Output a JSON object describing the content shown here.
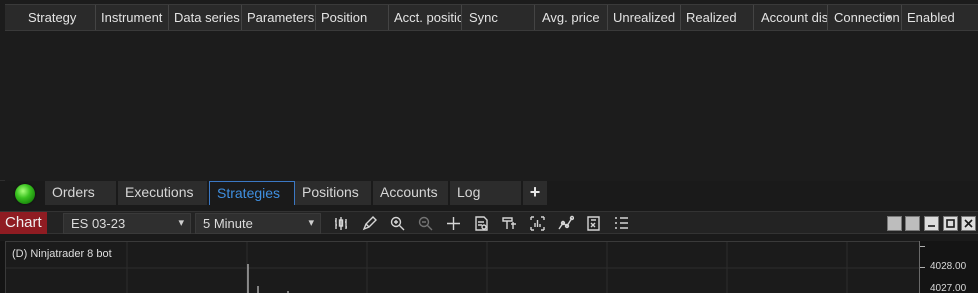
{
  "grid": {
    "columns": [
      "Strategy",
      "Instrument",
      "Data series",
      "Parameters",
      "Position",
      "Acct. position",
      "Sync",
      "Avg. price",
      "Unrealized",
      "Realized",
      "Account display name",
      "Connection",
      "Enabled"
    ]
  },
  "tabs": {
    "items": [
      "Orders",
      "Executions",
      "Strategies",
      "Positions",
      "Accounts",
      "Log"
    ],
    "active": "Strategies",
    "add_label": "+"
  },
  "toolbar": {
    "chart_label": "Chart",
    "instrument": "ES 03-23",
    "interval": "5 Minute"
  },
  "chart": {
    "title": "(D) Ninjatrader 8 bot",
    "y_ticks": [
      "4028.00",
      "4027.00"
    ],
    "bg_color": "#1b1b1b"
  },
  "colors": {
    "chart_label_bg": "#8f1c22",
    "active_tab": "#3f8fe0",
    "status_dot": "#39c21f"
  }
}
